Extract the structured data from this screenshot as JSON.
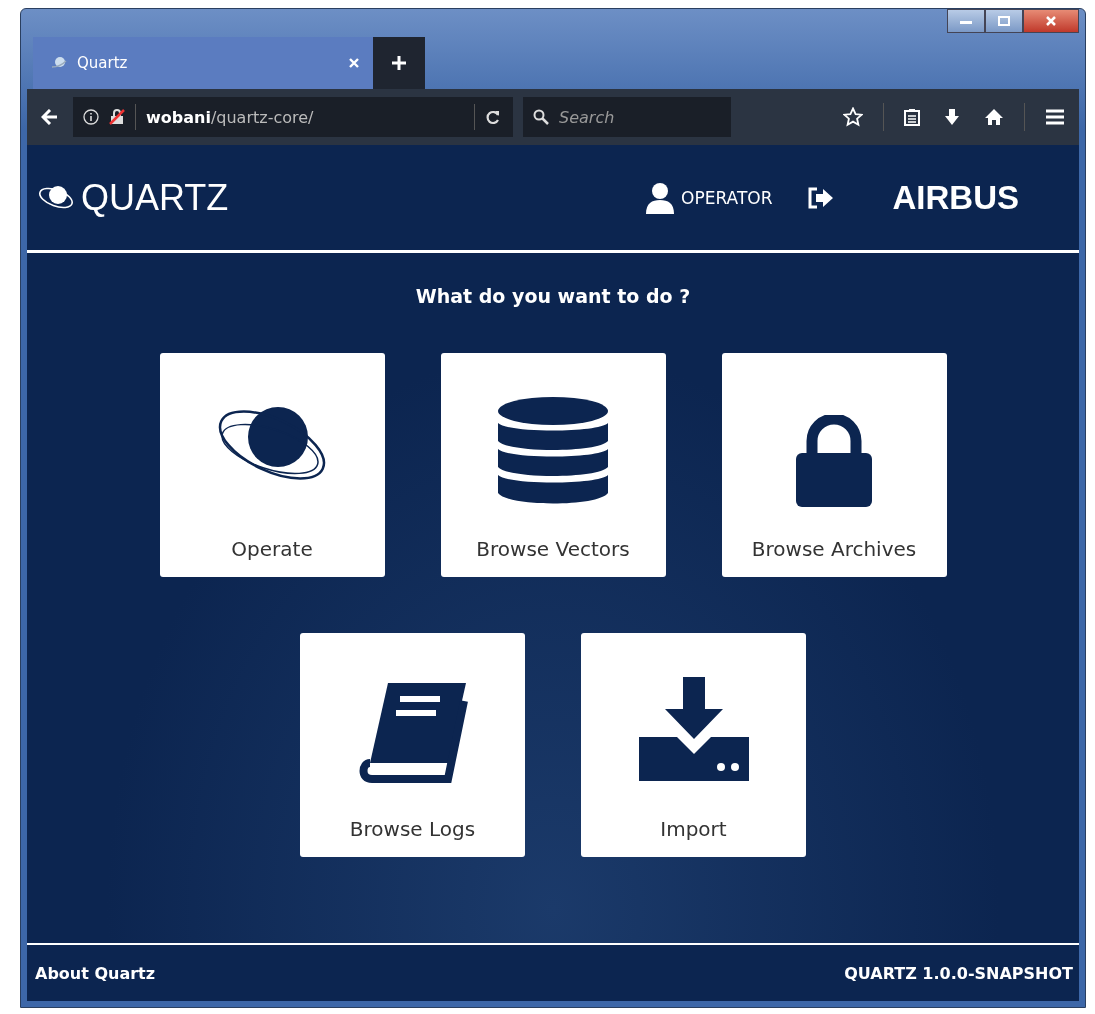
{
  "browser": {
    "tabs": [
      {
        "title": "Quartz",
        "selected": true
      }
    ],
    "address": {
      "host": "wobani",
      "path": "/quartz-core/"
    },
    "search": {
      "placeholder": "Search"
    }
  },
  "app": {
    "brand": "QUARTZ",
    "user": "OPERATOR",
    "company": "AIRBUS",
    "prompt": "What do you want to do ?",
    "tiles": [
      {
        "label": "Operate",
        "kind": "operate"
      },
      {
        "label": "Browse Vectors",
        "kind": "vectors"
      },
      {
        "label": "Browse Archives",
        "kind": "archives"
      },
      {
        "label": "Browse Logs",
        "kind": "logs"
      },
      {
        "label": "Import",
        "kind": "import"
      }
    ],
    "footer": {
      "about": "About Quartz",
      "version": "QUARTZ 1.0.0-SNAPSHOT"
    }
  }
}
